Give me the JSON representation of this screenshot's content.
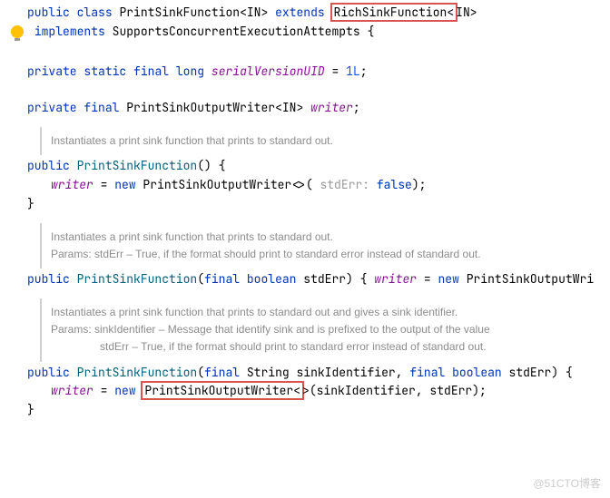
{
  "l1": {
    "kw_public": "public",
    "kw_class": "class",
    "cls": "PrintSinkFunction",
    "gen_l": "<",
    "gen_in": "IN",
    "gen_r": ">",
    "kw_extends": "extends",
    "super": "RichSinkFunction",
    "gen_l2": "<",
    "gen_in2": "IN",
    "gen_r2": ">"
  },
  "l2": {
    "kw_implements": "implements",
    "iface": "SupportsConcurrentExecutionAttempts",
    "brace": " {"
  },
  "l3": {
    "kw_private": "private",
    "kw_static": "static",
    "kw_final": "final",
    "kw_long": "long",
    "field": "serialVersionUID",
    "eq": " = ",
    "val": "1L",
    "semi": ";"
  },
  "l4": {
    "kw_private": "private",
    "kw_final": "final",
    "type": "PrintSinkOutputWriter",
    "gen": "<IN>",
    "field": " writer",
    "semi": ";"
  },
  "doc1": {
    "text": "Instantiates a print sink function that prints to standard out."
  },
  "l5": {
    "kw_public": "public",
    "ctor": "PrintSinkFunction",
    "rest": "() {"
  },
  "l6": {
    "field": "writer",
    "eq": " = ",
    "kw_new": "new",
    "type": " PrintSinkOutputWriter<>( ",
    "hint": "stdErr:",
    "kw_false": " false",
    "rest": ");"
  },
  "l7": {
    "brace": "}"
  },
  "doc2": {
    "text": "Instantiates a print sink function that prints to standard out.",
    "params_label": "Params:",
    "params_text": " stdErr – True, if the format should print to standard error instead of standard out."
  },
  "l8": {
    "kw_public": "public",
    "ctor": "PrintSinkFunction",
    "open": "(",
    "kw_final": "final",
    "kw_boolean": " boolean",
    "param": " stdErr",
    "close": ") { ",
    "field": "writer",
    "eq": " = ",
    "kw_new": "new",
    "type": " PrintSinkOutputWri"
  },
  "doc3": {
    "text": "Instantiates a print sink function that prints to standard out and gives a sink identifier.",
    "params_label": "Params:",
    "p1": " sinkIdentifier – Message that identify sink and is prefixed to the output of the value",
    "p2": "stdErr – True, if the format should print to standard error instead of standard out."
  },
  "l9": {
    "kw_public": "public",
    "ctor": "PrintSinkFunction",
    "open": "(",
    "kw_final1": "final",
    "type_str": " String",
    "param1": " sinkIdentifier",
    "comma": ", ",
    "kw_final2": "final",
    "kw_boolean": " boolean",
    "param2": " stdErr",
    "close": ") {"
  },
  "l10": {
    "field": "writer",
    "eq": " = ",
    "kw_new": "new ",
    "boxed": "PrintSinkOutputWriter<",
    "rest": ">(sinkIdentifier, stdErr);"
  },
  "l11": {
    "brace": "}"
  },
  "watermark": "@51CTO博客"
}
